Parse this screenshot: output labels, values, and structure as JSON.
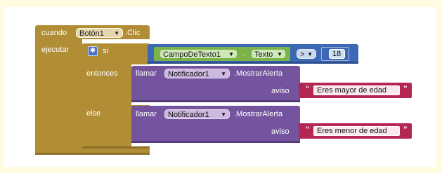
{
  "event": {
    "cuando_label": "cuando",
    "component": "Botón1",
    "event_name": ".Clic",
    "ejecutar_label": "ejecutar"
  },
  "if_block": {
    "si_label": "si",
    "entonces_label": "entonces",
    "else_label": "else"
  },
  "condition": {
    "component": "CampoDeTexto1",
    "dot": ".",
    "property": "Texto",
    "operator": ">",
    "value": "18"
  },
  "then_call": {
    "llamar_label": "llamar",
    "component": "Notificador1",
    "method": ".MostrarAlerta",
    "param_label": "aviso",
    "text": "Eres mayor de edad"
  },
  "else_call": {
    "llamar_label": "llamar",
    "component": "Notificador1",
    "method": ".MostrarAlerta",
    "param_label": "aviso",
    "text": "Eres menor de edad"
  },
  "icons": {
    "dropdown_arrow": "chevron-down-icon",
    "mutator": "gear-icon",
    "quote": "quote-icon"
  },
  "colors": {
    "event_block": "#b18e35",
    "control_block": "#b18e35",
    "procedure_block": "#74549e",
    "math_block": "#3c68b6",
    "component_block": "#7ab34a",
    "text_block": "#b42753",
    "background": "#fffbe0"
  }
}
